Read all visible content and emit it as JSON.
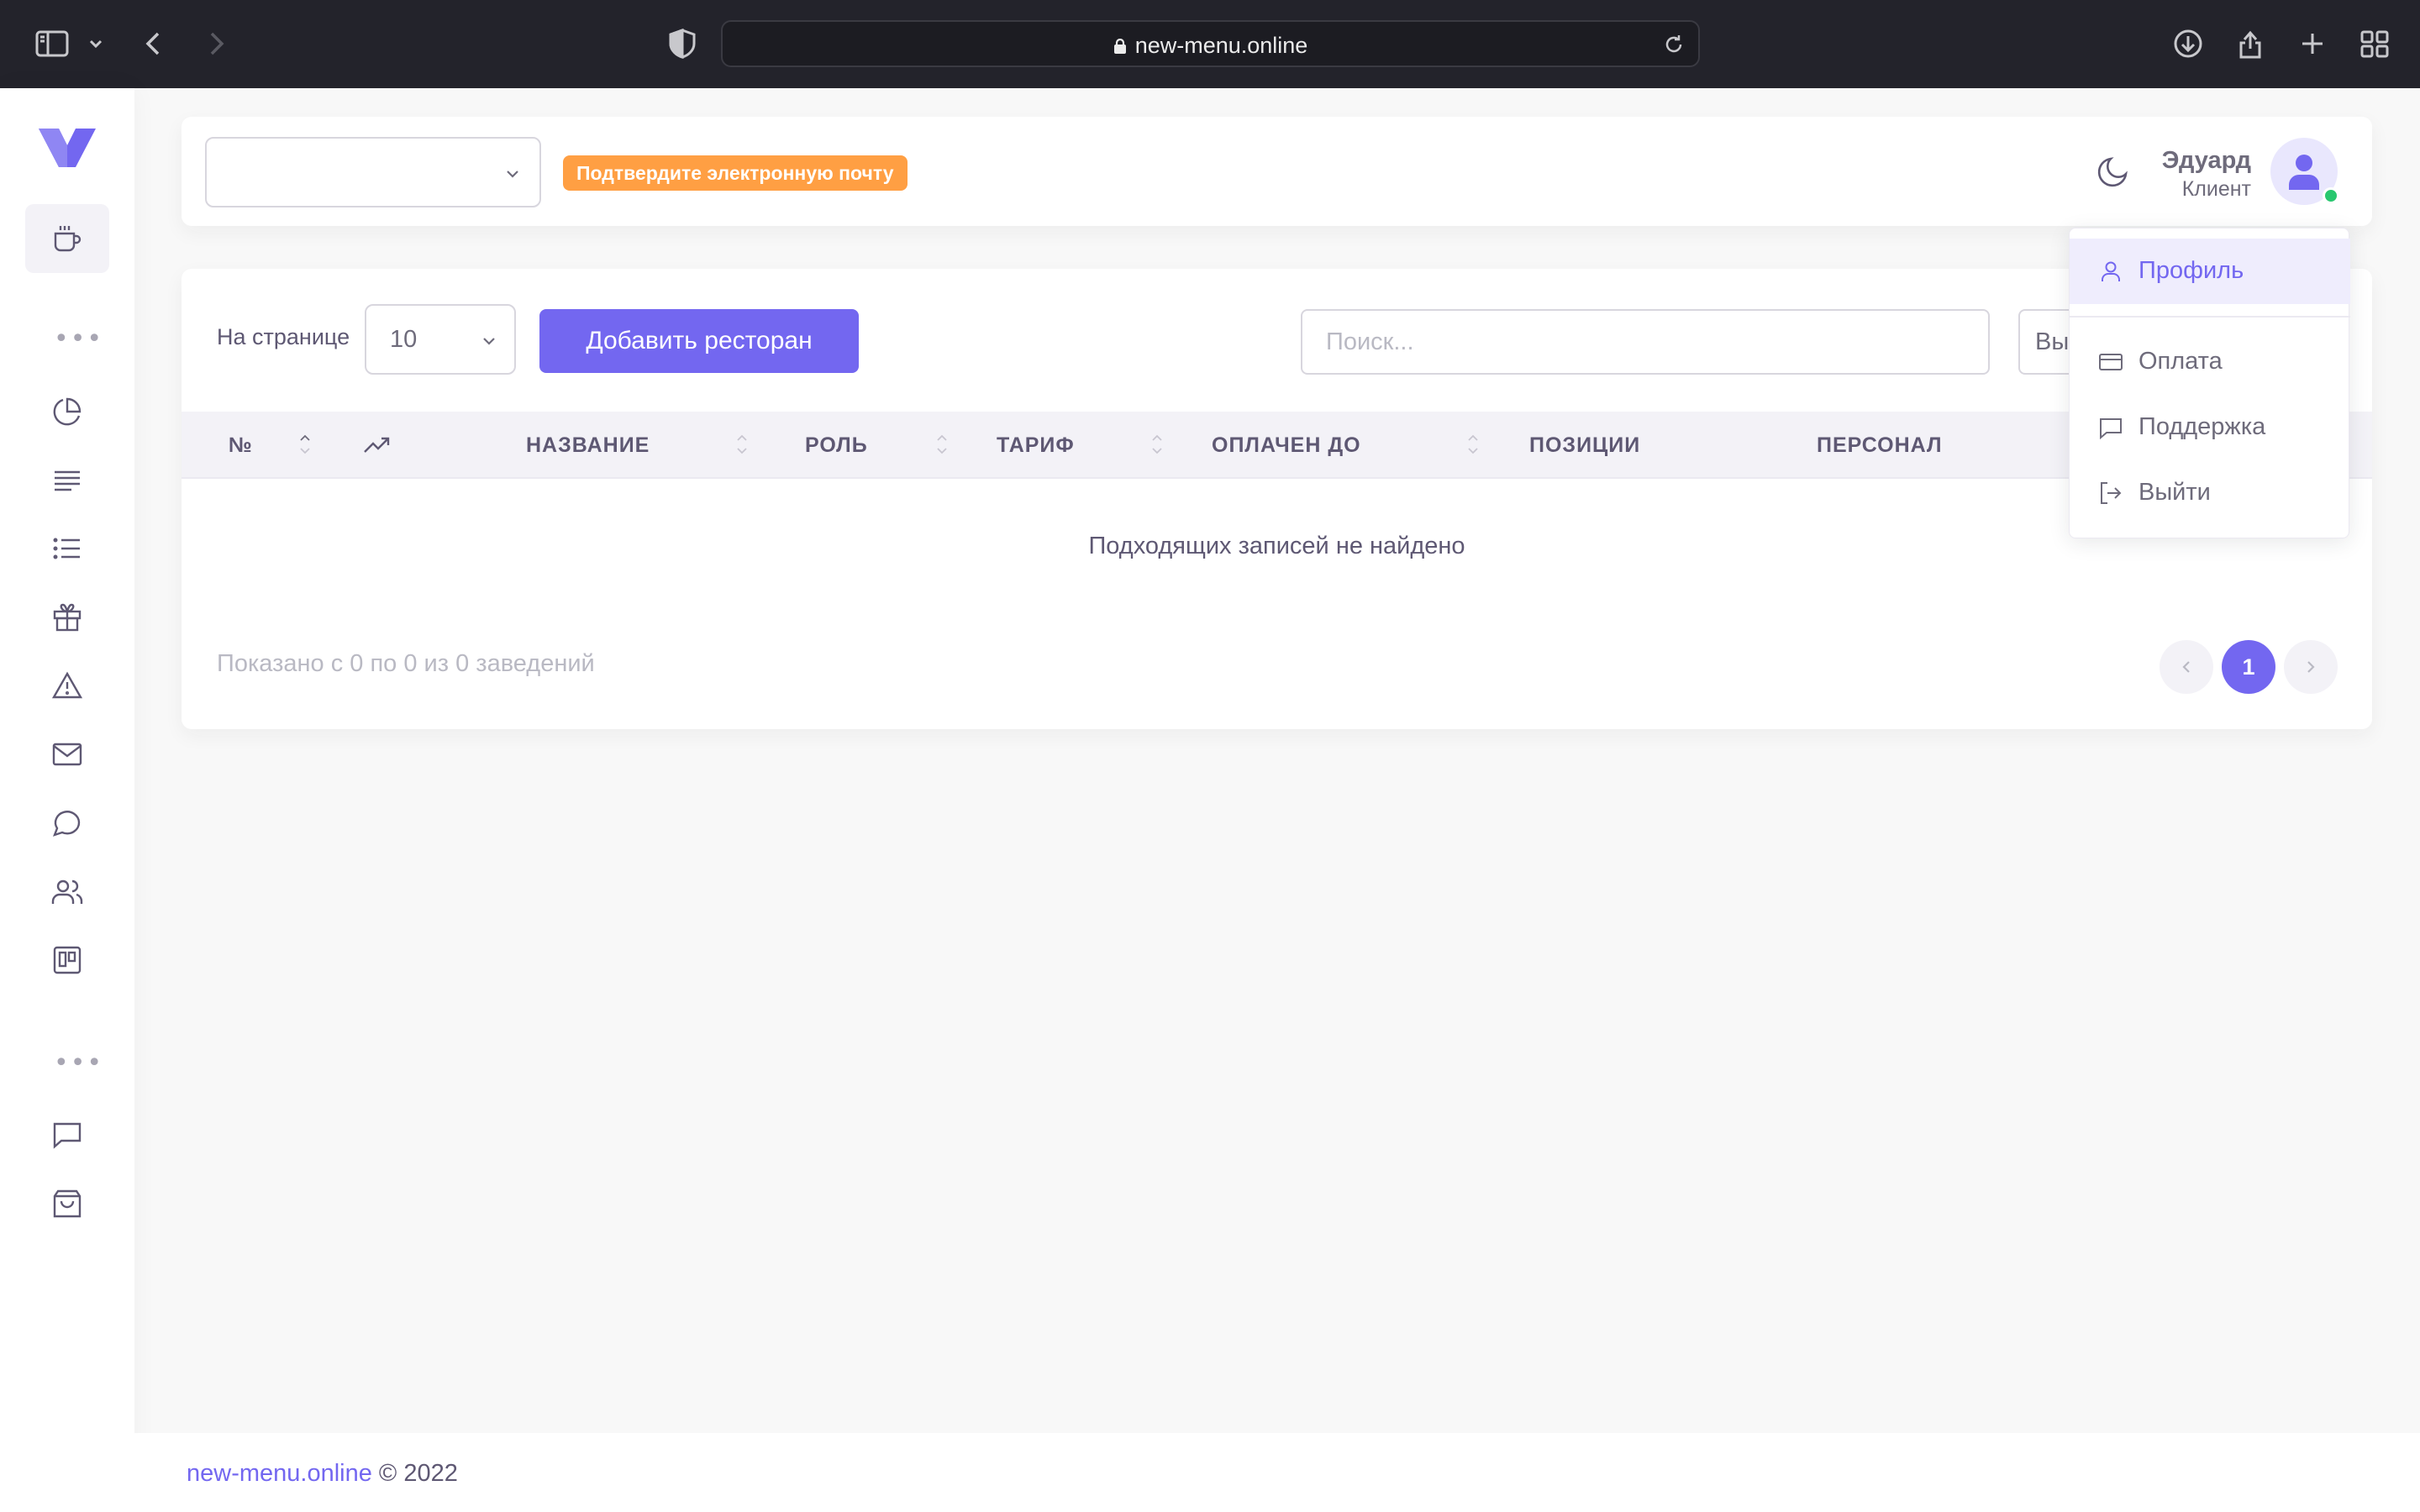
{
  "browser": {
    "url": "new-menu.online"
  },
  "header": {
    "restaurant_select_value": "",
    "email_badge": "Подтвердите электронную почту",
    "user_name": "Эдуард",
    "user_role": "Клиент"
  },
  "toolbar": {
    "per_page_label": "На странице",
    "per_page_value": "10",
    "add_button": "Добавить ресторан",
    "search_placeholder": "Поиск...",
    "filter_value": "Вы"
  },
  "table": {
    "columns": [
      "№",
      "НАЗВАНИЕ",
      "РОЛЬ",
      "ТАРИФ",
      "ОПЛАЧЕН ДО",
      "ПОЗИЦИИ",
      "ПЕРСОНАЛ"
    ],
    "empty_message": "Подходящих записей не найдено"
  },
  "pagination": {
    "info": "Показано с 0 по 0 из 0 заведений",
    "current_page": "1"
  },
  "user_menu": {
    "items": [
      "Профиль",
      "Оплата",
      "Поддержка",
      "Выйти"
    ]
  },
  "footer": {
    "link": "new-menu.online",
    "copyright": " © 2022"
  },
  "colors": {
    "primary": "#7367f0",
    "warning": "#ff9f43",
    "success": "#28c76f"
  }
}
